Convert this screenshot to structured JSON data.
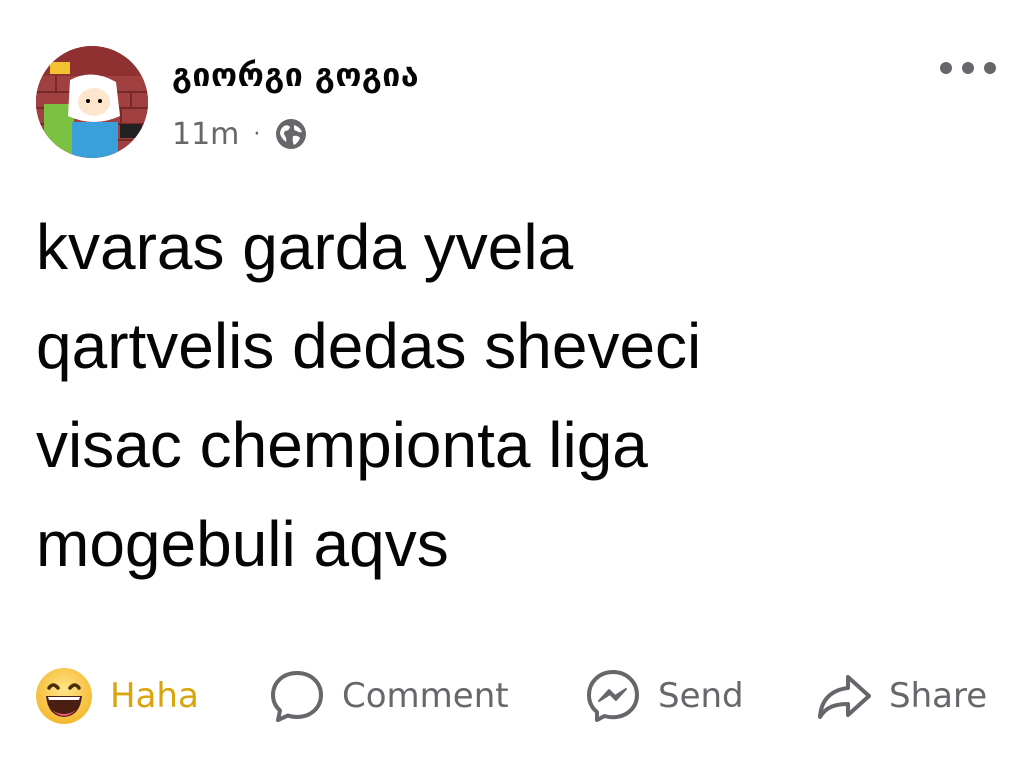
{
  "post": {
    "author_name": "გიორგი გოგია",
    "time_ago": "11m",
    "separator": "·",
    "privacy_icon": "globe-icon",
    "text_lines": [
      "kvaras garda yvela",
      "qartvelis dedas sheveci",
      "visac chempionta liga",
      "mogebuli aqvs"
    ]
  },
  "actions": {
    "reaction_label": "Haha",
    "comment_label": "Comment",
    "send_label": "Send",
    "share_label": "Share"
  },
  "colors": {
    "text": "#050505",
    "secondary": "#65676b",
    "haha": "#d9a40c"
  }
}
